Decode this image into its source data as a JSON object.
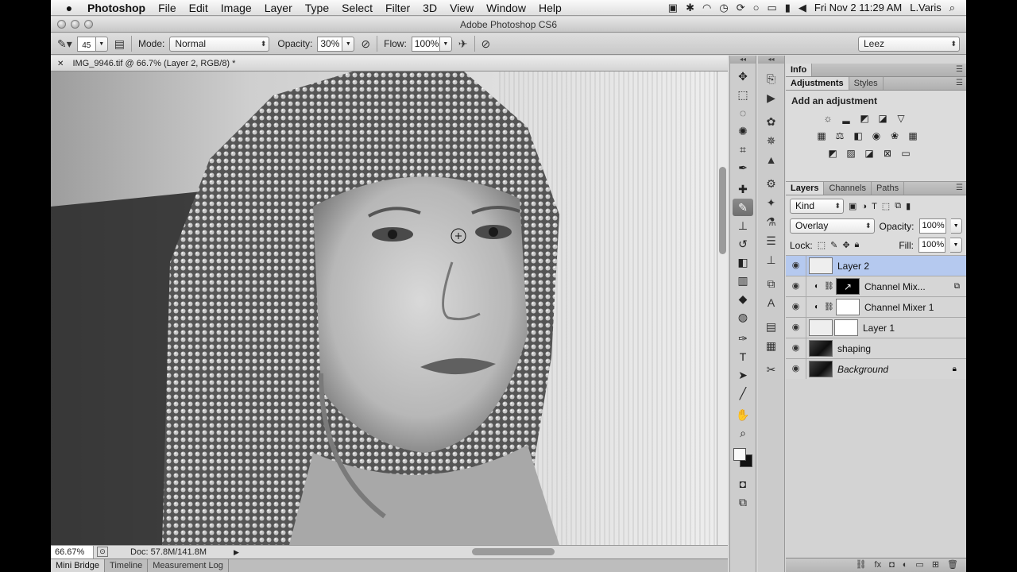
{
  "menubar": {
    "app": "Photoshop",
    "items": [
      "File",
      "Edit",
      "Image",
      "Layer",
      "Type",
      "Select",
      "Filter",
      "3D",
      "View",
      "Window",
      "Help"
    ],
    "datetime": "Fri Nov 2  11:29 AM",
    "user": "L.Varis"
  },
  "window": {
    "title": "Adobe Photoshop CS6"
  },
  "options": {
    "brush_size": "45",
    "mode_label": "Mode:",
    "mode_value": "Normal",
    "opacity_label": "Opacity:",
    "opacity_value": "30%",
    "flow_label": "Flow:",
    "flow_value": "100%",
    "workspace": "Leez"
  },
  "document": {
    "tab": "IMG_9946.tif @ 66.7% (Layer 2, RGB/8) *",
    "zoom": "66.67%",
    "doc_size": "Doc: 57.8M/141.8M"
  },
  "bottom_tabs": [
    "Mini Bridge",
    "Timeline",
    "Measurement Log"
  ],
  "panels": {
    "info_tab": "Info",
    "adj_tabs": [
      "Adjustments",
      "Styles"
    ],
    "adj_title": "Add an adjustment",
    "layer_tabs": [
      "Layers",
      "Channels",
      "Paths"
    ],
    "kind_value": "Kind",
    "blend_value": "Overlay",
    "opacity_label": "Opacity:",
    "opacity_value": "100%",
    "lock_label": "Lock:",
    "fill_label": "Fill:",
    "fill_value": "100%"
  },
  "layers": [
    {
      "name": "Layer 2",
      "selected": true
    },
    {
      "name": "Channel Mix..."
    },
    {
      "name": "Channel Mixer 1"
    },
    {
      "name": "Layer 1"
    },
    {
      "name": "shaping"
    },
    {
      "name": "Background",
      "locked": true
    }
  ],
  "colors": {
    "selection": "#b5c9ef",
    "foreground": "#fafafa",
    "background": "#111111"
  }
}
